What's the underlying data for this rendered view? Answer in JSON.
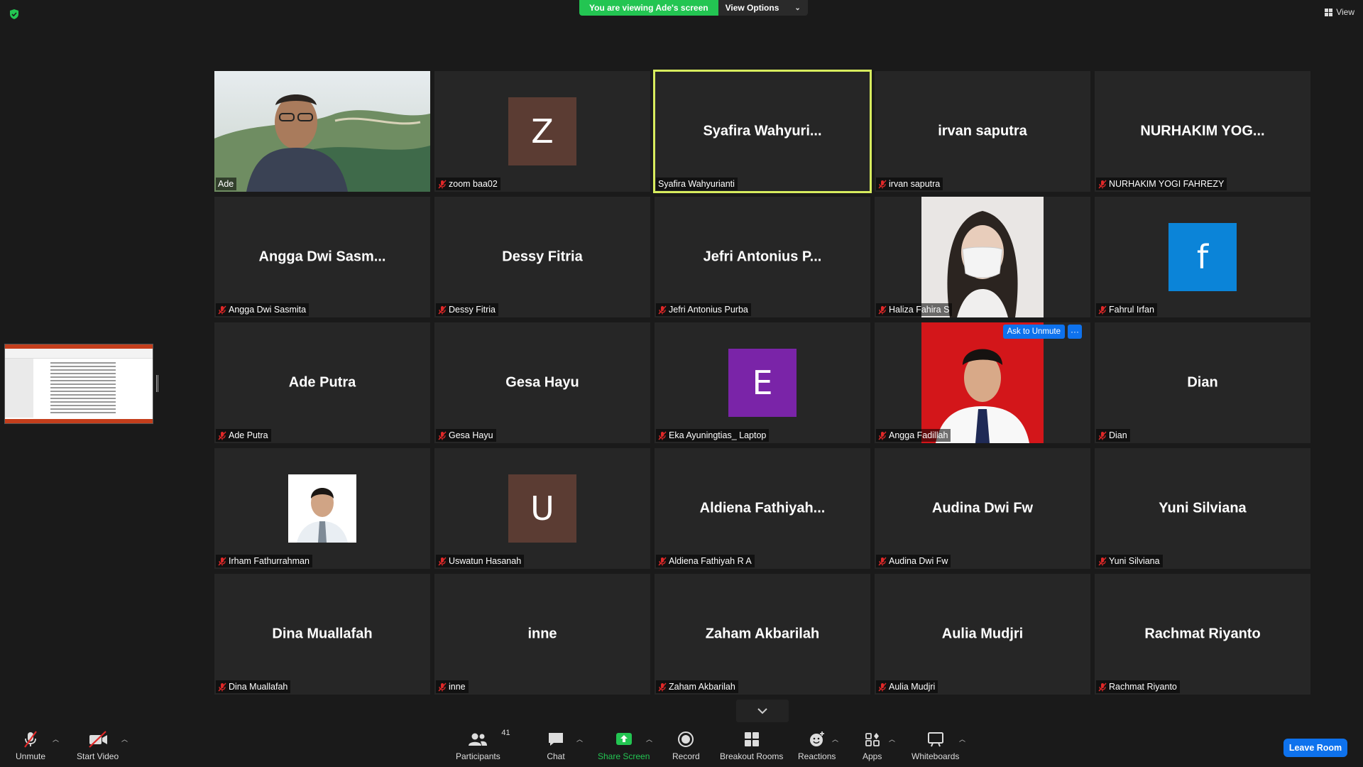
{
  "banner": {
    "viewing_text": "You are viewing Ade's screen",
    "view_options": "View Options"
  },
  "view_button": "View",
  "participants_grid": [
    {
      "big": "",
      "tag": "Ade",
      "kind": "video",
      "muted": false
    },
    {
      "big": "",
      "tag": "zoom baa02",
      "kind": "letter",
      "letter": "Z",
      "color": "#5b3c33",
      "muted": true
    },
    {
      "big": "Syafira  Wahyuri...",
      "tag": "Syafira Wahyurianti",
      "kind": "name",
      "muted": false,
      "active": true
    },
    {
      "big": "irvan saputra",
      "tag": "irvan saputra",
      "kind": "name",
      "muted": true
    },
    {
      "big": "NURHAKIM  YOG...",
      "tag": "NURHAKIM YOGI FAHREZY",
      "kind": "name",
      "muted": true
    },
    {
      "big": "Angga  Dwi  Sasm...",
      "tag": "Angga Dwi Sasmita",
      "kind": "name",
      "muted": true
    },
    {
      "big": "Dessy Fitria",
      "tag": "Dessy Fitria",
      "kind": "name",
      "muted": true
    },
    {
      "big": "Jefri  Antonius  P...",
      "tag": "Jefri Antonius Purba",
      "kind": "name",
      "muted": true
    },
    {
      "big": "",
      "tag": "Haliza Fahira S",
      "kind": "photo-mask",
      "muted": true
    },
    {
      "big": "",
      "tag": "Fahrul Irfan",
      "kind": "letter",
      "letter": "f",
      "color": "#0b84d8",
      "muted": true
    },
    {
      "big": "Ade Putra",
      "tag": "Ade Putra",
      "kind": "name",
      "muted": true
    },
    {
      "big": "Gesa Hayu",
      "tag": "Gesa Hayu",
      "kind": "name",
      "muted": true
    },
    {
      "big": "",
      "tag": "Eka Ayuningtias_ Laptop",
      "kind": "letter",
      "letter": "E",
      "color": "#7a24a8",
      "muted": true
    },
    {
      "big": "",
      "tag": "Angga Fadillah",
      "kind": "photo-red",
      "muted": true,
      "hover": true
    },
    {
      "big": "Dian",
      "tag": "Dian",
      "kind": "name",
      "muted": true
    },
    {
      "big": "",
      "tag": "Irham Fathurrahman",
      "kind": "photo-small",
      "muted": true
    },
    {
      "big": "",
      "tag": "Uswatun Hasanah",
      "kind": "letter",
      "letter": "U",
      "color": "#5b3c33",
      "muted": true
    },
    {
      "big": "Aldiena  Fathiyah...",
      "tag": "Aldiena Fathiyah R A",
      "kind": "name",
      "muted": true
    },
    {
      "big": "Audina Dwi Fw",
      "tag": "Audina Dwi Fw",
      "kind": "name",
      "muted": true
    },
    {
      "big": "Yuni Silviana",
      "tag": "Yuni Silviana",
      "kind": "name",
      "muted": true
    },
    {
      "big": "Dina Muallafah",
      "tag": "Dina Muallafah",
      "kind": "name",
      "muted": true
    },
    {
      "big": "inne",
      "tag": "inne",
      "kind": "name",
      "muted": true
    },
    {
      "big": "Zaham Akbarilah",
      "tag": "Zaham Akbarilah",
      "kind": "name",
      "muted": true
    },
    {
      "big": "Aulia Mudjri",
      "tag": "Aulia Mudjri",
      "kind": "name",
      "muted": true
    },
    {
      "big": "Rachmat Riyanto",
      "tag": "Rachmat Riyanto",
      "kind": "name",
      "muted": true
    }
  ],
  "hover_actions": {
    "ask_unmute": "Ask to Unmute",
    "more": "···"
  },
  "toolbar": {
    "unmute": "Unmute",
    "start_video": "Start Video",
    "participants": "Participants",
    "participants_count": "41",
    "chat": "Chat",
    "share_screen": "Share Screen",
    "record": "Record",
    "breakout_rooms": "Breakout Rooms",
    "reactions": "Reactions",
    "apps": "Apps",
    "whiteboards": "Whiteboards",
    "leave_room": "Leave Room"
  },
  "colors": {
    "accent_green": "#23c552",
    "active_speaker": "#d7ec5e",
    "zoom_blue": "#0e72ed",
    "muted_red": "#e02828"
  }
}
